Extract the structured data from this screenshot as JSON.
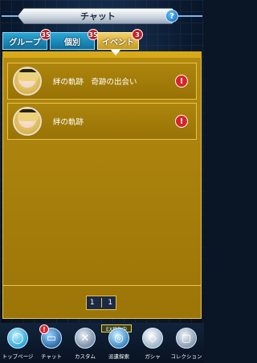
{
  "header": {
    "title": "チャット",
    "help": "?"
  },
  "tabs": [
    {
      "label": "グループ",
      "badge": "35"
    },
    {
      "label": "個別",
      "badge": "35"
    },
    {
      "label": "イベント",
      "badge": "3"
    }
  ],
  "chat_rows": [
    {
      "title": "絆の軌跡　奇跡の出会い",
      "alert": "!"
    },
    {
      "title": "絆の軌跡",
      "alert": "!"
    }
  ],
  "pager": {
    "current": "1",
    "total": "1"
  },
  "ex_badge": "EX発生中",
  "nav": [
    {
      "label": "トップページ",
      "icon": "egg-icon"
    },
    {
      "label": "チャット",
      "icon": "chat-icon",
      "badge": "!"
    },
    {
      "label": "カスタム",
      "icon": "tools-icon"
    },
    {
      "label": "派遣探索",
      "icon": "radar-icon"
    },
    {
      "label": "ガシャ",
      "icon": "gem-icon"
    },
    {
      "label": "コレクション",
      "icon": "bag-icon"
    }
  ],
  "colors": {
    "panel": "#9c7508",
    "tab_active": "#c79a1e",
    "tab_inactive": "#0f6f9e",
    "alert": "#d9232b"
  }
}
